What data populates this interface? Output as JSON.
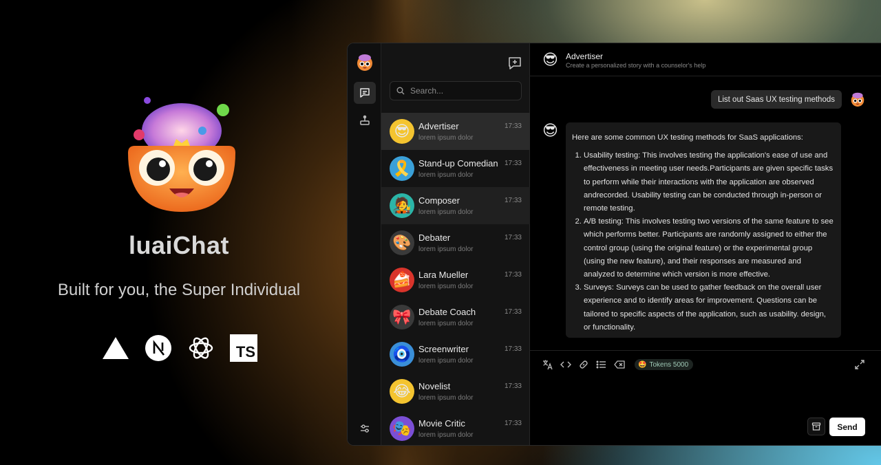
{
  "hero": {
    "title": "luaiChat",
    "tagline": "Built for you, the Super Individual",
    "tech_icons": [
      "vercel-icon",
      "nextjs-icon",
      "openai-icon",
      "typescript-icon"
    ],
    "ts_label": "TS"
  },
  "sidebar": {
    "search_placeholder": "Search...",
    "sessions": [
      {
        "name": "Advertiser",
        "desc": "lorem ipsum dolor",
        "time": "17:33",
        "avatar": "😎",
        "bg": "#f4c430"
      },
      {
        "name": "Stand-up Comedian",
        "desc": "lorem ipsum dolor",
        "time": "17:33",
        "avatar": "🎗️",
        "bg": "#3aa0d8"
      },
      {
        "name": "Composer",
        "desc": "lorem ipsum dolor",
        "time": "17:33",
        "avatar": "🧑‍🎤",
        "bg": "#2bb5a8"
      },
      {
        "name": "Debater",
        "desc": "lorem ipsum dolor",
        "time": "17:33",
        "avatar": "🎨",
        "bg": "#3a3a3a"
      },
      {
        "name": "Lara Mueller",
        "desc": "lorem ipsum dolor",
        "time": "17:33",
        "avatar": "🍰",
        "bg": "#d9342b"
      },
      {
        "name": "Debate Coach",
        "desc": "lorem ipsum dolor",
        "time": "17:33",
        "avatar": "🎀",
        "bg": "#3a3a3a"
      },
      {
        "name": "Screenwriter",
        "desc": "lorem ipsum dolor",
        "time": "17:33",
        "avatar": "🧿",
        "bg": "#3a8fd8"
      },
      {
        "name": "Novelist",
        "desc": "lorem ipsum dolor",
        "time": "17:33",
        "avatar": "😂",
        "bg": "#f4c430"
      },
      {
        "name": "Movie Critic",
        "desc": "lorem ipsum dolor",
        "time": "17:33",
        "avatar": "🎭",
        "bg": "#7b4fd6"
      }
    ]
  },
  "chat": {
    "title": "Advertiser",
    "subtitle": "Create a personalized story with a counselor's help",
    "user_message": "List out Saas UX testing methods",
    "bot_intro": "Here are some common UX testing methods for SaaS applications:",
    "bot_items": [
      "Usability testing: This involves testing the application's ease of use and effectiveness in meeting user needs.Participants are given specific tasks to perform while their interactions with the application are observed andrecorded. Usability testing can be conducted through in-person or remote testing.",
      "A/B testing: This involves testing two versions of the same feature to see which performs better. Participants are randomly assigned to either the control group (using the original feature) or the experimental group (using the new feature), and their responses are measured and analyzed to determine which version is more effective.",
      "Surveys: Surveys can be used to gather feedback on the overall user experience and to identify areas for improvement. Questions can be tailored to specific aspects of the application, such as usability. design, or functionality."
    ]
  },
  "input": {
    "tokens_label": "Tokens 5000",
    "send_label": "Send"
  }
}
